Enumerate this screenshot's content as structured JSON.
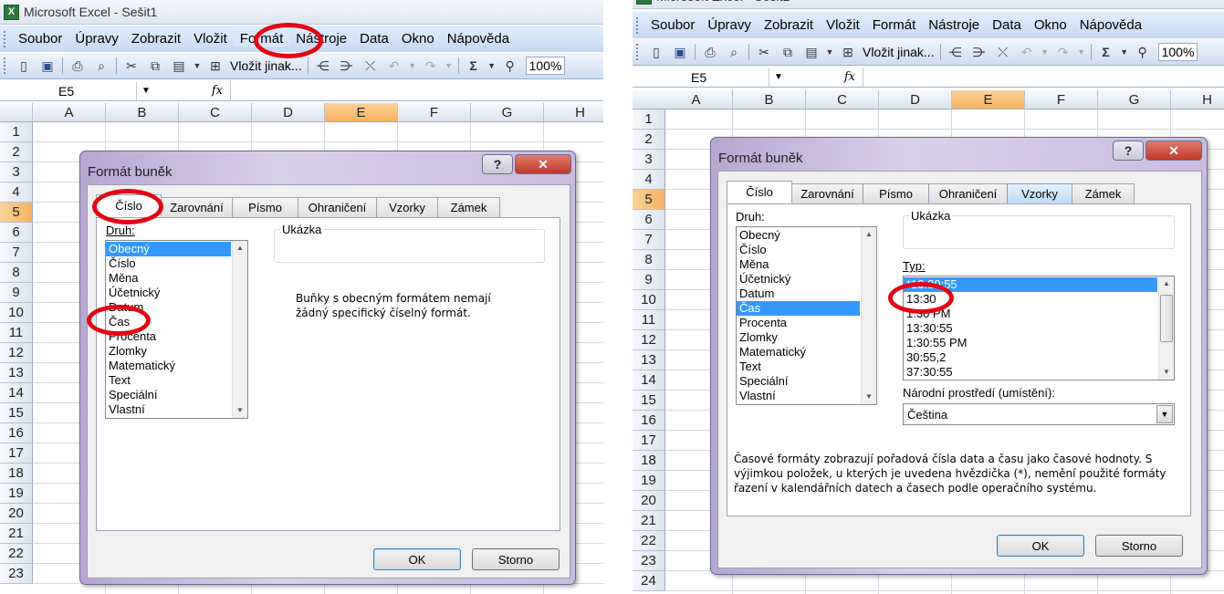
{
  "app": {
    "window_title": "Microsoft Excel - Sešit1",
    "icon_label": "X",
    "menu": [
      "Soubor",
      "Úpravy",
      "Zobrazit",
      "Vložit",
      "Formát",
      "Nástroje",
      "Data",
      "Okno",
      "Nápověda"
    ],
    "toolbar": {
      "paste_special_label": "Vložit jinak...",
      "zoom": "100%"
    },
    "name_box": "E5",
    "fx_label": "fx",
    "columns": [
      "A",
      "B",
      "C",
      "D",
      "E",
      "F",
      "G",
      "H"
    ],
    "selected_column": "E",
    "selected_row": "5"
  },
  "left": {
    "rows": [
      "1",
      "2",
      "3",
      "4",
      "5",
      "6",
      "7",
      "8",
      "9",
      "10",
      "11",
      "12",
      "13",
      "14",
      "15",
      "16",
      "17",
      "18",
      "19",
      "20",
      "21",
      "22",
      "23"
    ],
    "dialog": {
      "title": "Formát buněk",
      "tabs": [
        "Číslo",
        "Zarovnání",
        "Písmo",
        "Ohraničení",
        "Vzorky",
        "Zámek"
      ],
      "druh_label": "Druh:",
      "druh_items": [
        "Obecný",
        "Číslo",
        "Měna",
        "Účetnický",
        "Datum",
        "Čas",
        "Procenta",
        "Zlomky",
        "Matematický",
        "Text",
        "Speciální",
        "Vlastní"
      ],
      "selected_druh": "Obecný",
      "ukazka_label": "Ukázka",
      "description": "Buňky s obecným formátem nemají\nžádný specifický číselný formát.",
      "ok": "OK",
      "cancel": "Storno"
    }
  },
  "right": {
    "rows": [
      "1",
      "2",
      "3",
      "4",
      "5",
      "6",
      "7",
      "8",
      "9",
      "10",
      "11",
      "12",
      "13",
      "14",
      "15",
      "16",
      "17",
      "18",
      "19",
      "20",
      "21",
      "22",
      "23",
      "24"
    ],
    "dialog": {
      "title": "Formát buněk",
      "tabs": [
        "Číslo",
        "Zarovnání",
        "Písmo",
        "Ohraničení",
        "Vzorky",
        "Zámek"
      ],
      "druh_label": "Druh:",
      "druh_items": [
        "Obecný",
        "Číslo",
        "Měna",
        "Účetnický",
        "Datum",
        "Čas",
        "Procenta",
        "Zlomky",
        "Matematický",
        "Text",
        "Speciální",
        "Vlastní"
      ],
      "selected_druh": "Čas",
      "ukazka_label": "Ukázka",
      "typ_label": "Typ:",
      "typ_items": [
        "*13:30:55",
        "13:30",
        "1:30 PM",
        "13:30:55",
        "1:30:55 PM",
        "30:55,2",
        "37:30:55"
      ],
      "selected_typ": "*13:30:55",
      "locale_label": "Národní prostředí (umístění):",
      "locale_value": "Čeština",
      "description": "Časové formáty zobrazují pořadová čísla data a času jako časové hodnoty. S výjimkou položek, u kterých je uvedena hvězdička (*), nemění použité formáty řazení v kalendářních datech a časech podle operačního systému.",
      "ok": "OK",
      "cancel": "Storno"
    }
  },
  "colors": {
    "highlight_ring": "#e30613",
    "selection_blue": "#3399ff",
    "selected_header": "#f6b160"
  }
}
